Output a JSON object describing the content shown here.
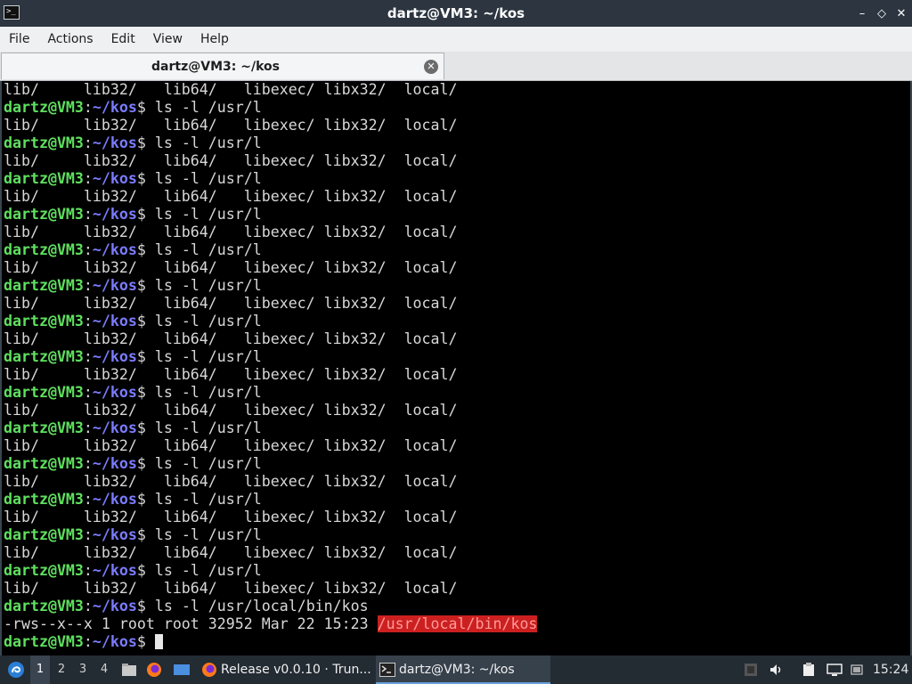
{
  "window": {
    "title": "dartz@VM3: ~/kos",
    "controls": [
      "–",
      "◇",
      "✕"
    ]
  },
  "menu": [
    "File",
    "Actions",
    "Edit",
    "View",
    "Help"
  ],
  "tab": {
    "label": "dartz@VM3: ~/kos",
    "close": "✕"
  },
  "terminal": {
    "prompt_user": "dartz@VM3",
    "prompt_path": "~/kos",
    "listing": [
      "lib/",
      "lib32/",
      "lib64/",
      "libexec/",
      "libx32/",
      "local/"
    ],
    "lines": [
      {
        "type": "out",
        "text": "lib/     lib32/   lib64/   libexec/ libx32/  local/"
      },
      {
        "type": "cmd",
        "text": "ls -l /usr/l"
      },
      {
        "type": "out",
        "text": "lib/     lib32/   lib64/   libexec/ libx32/  local/"
      },
      {
        "type": "cmd",
        "text": "ls -l /usr/l"
      },
      {
        "type": "out",
        "text": "lib/     lib32/   lib64/   libexec/ libx32/  local/"
      },
      {
        "type": "cmd",
        "text": "ls -l /usr/l"
      },
      {
        "type": "out",
        "text": "lib/     lib32/   lib64/   libexec/ libx32/  local/"
      },
      {
        "type": "cmd",
        "text": "ls -l /usr/l"
      },
      {
        "type": "out",
        "text": "lib/     lib32/   lib64/   libexec/ libx32/  local/"
      },
      {
        "type": "cmd",
        "text": "ls -l /usr/l"
      },
      {
        "type": "out",
        "text": "lib/     lib32/   lib64/   libexec/ libx32/  local/"
      },
      {
        "type": "cmd",
        "text": "ls -l /usr/l"
      },
      {
        "type": "out",
        "text": "lib/     lib32/   lib64/   libexec/ libx32/  local/"
      },
      {
        "type": "cmd",
        "text": "ls -l /usr/l"
      },
      {
        "type": "out",
        "text": "lib/     lib32/   lib64/   libexec/ libx32/  local/"
      },
      {
        "type": "cmd",
        "text": "ls -l /usr/l"
      },
      {
        "type": "out",
        "text": "lib/     lib32/   lib64/   libexec/ libx32/  local/"
      },
      {
        "type": "cmd",
        "text": "ls -l /usr/l"
      },
      {
        "type": "out",
        "text": "lib/     lib32/   lib64/   libexec/ libx32/  local/"
      },
      {
        "type": "cmd",
        "text": "ls -l /usr/l"
      },
      {
        "type": "out",
        "text": "lib/     lib32/   lib64/   libexec/ libx32/  local/"
      },
      {
        "type": "cmd",
        "text": "ls -l /usr/l"
      },
      {
        "type": "out",
        "text": "lib/     lib32/   lib64/   libexec/ libx32/  local/"
      },
      {
        "type": "cmd",
        "text": "ls -l /usr/l"
      },
      {
        "type": "out",
        "text": "lib/     lib32/   lib64/   libexec/ libx32/  local/"
      },
      {
        "type": "cmd",
        "text": "ls -l /usr/l"
      },
      {
        "type": "out",
        "text": "lib/     lib32/   lib64/   libexec/ libx32/  local/"
      },
      {
        "type": "cmd",
        "text": "ls -l /usr/l"
      },
      {
        "type": "out",
        "text": "lib/     lib32/   lib64/   libexec/ libx32/  local/"
      },
      {
        "type": "cmd",
        "text": "ls -l /usr/local/bin/kos"
      },
      {
        "type": "perm",
        "text": "-rws--x--x 1 root root 32952 Mar 22 15:23 ",
        "highlight": "/usr/local/bin/kos"
      },
      {
        "type": "cmd",
        "text": "",
        "cursor": true
      }
    ]
  },
  "taskbar": {
    "workspaces": [
      "1",
      "2",
      "3",
      "4"
    ],
    "active_workspace": "1",
    "tasks": [
      {
        "label": "Release v0.0.10 · Trun...",
        "icon": "firefox-icon"
      },
      {
        "label": "dartz@VM3: ~/kos",
        "icon": "terminal-icon"
      }
    ],
    "clock": "15:24",
    "accent": "#6aa0d8"
  }
}
